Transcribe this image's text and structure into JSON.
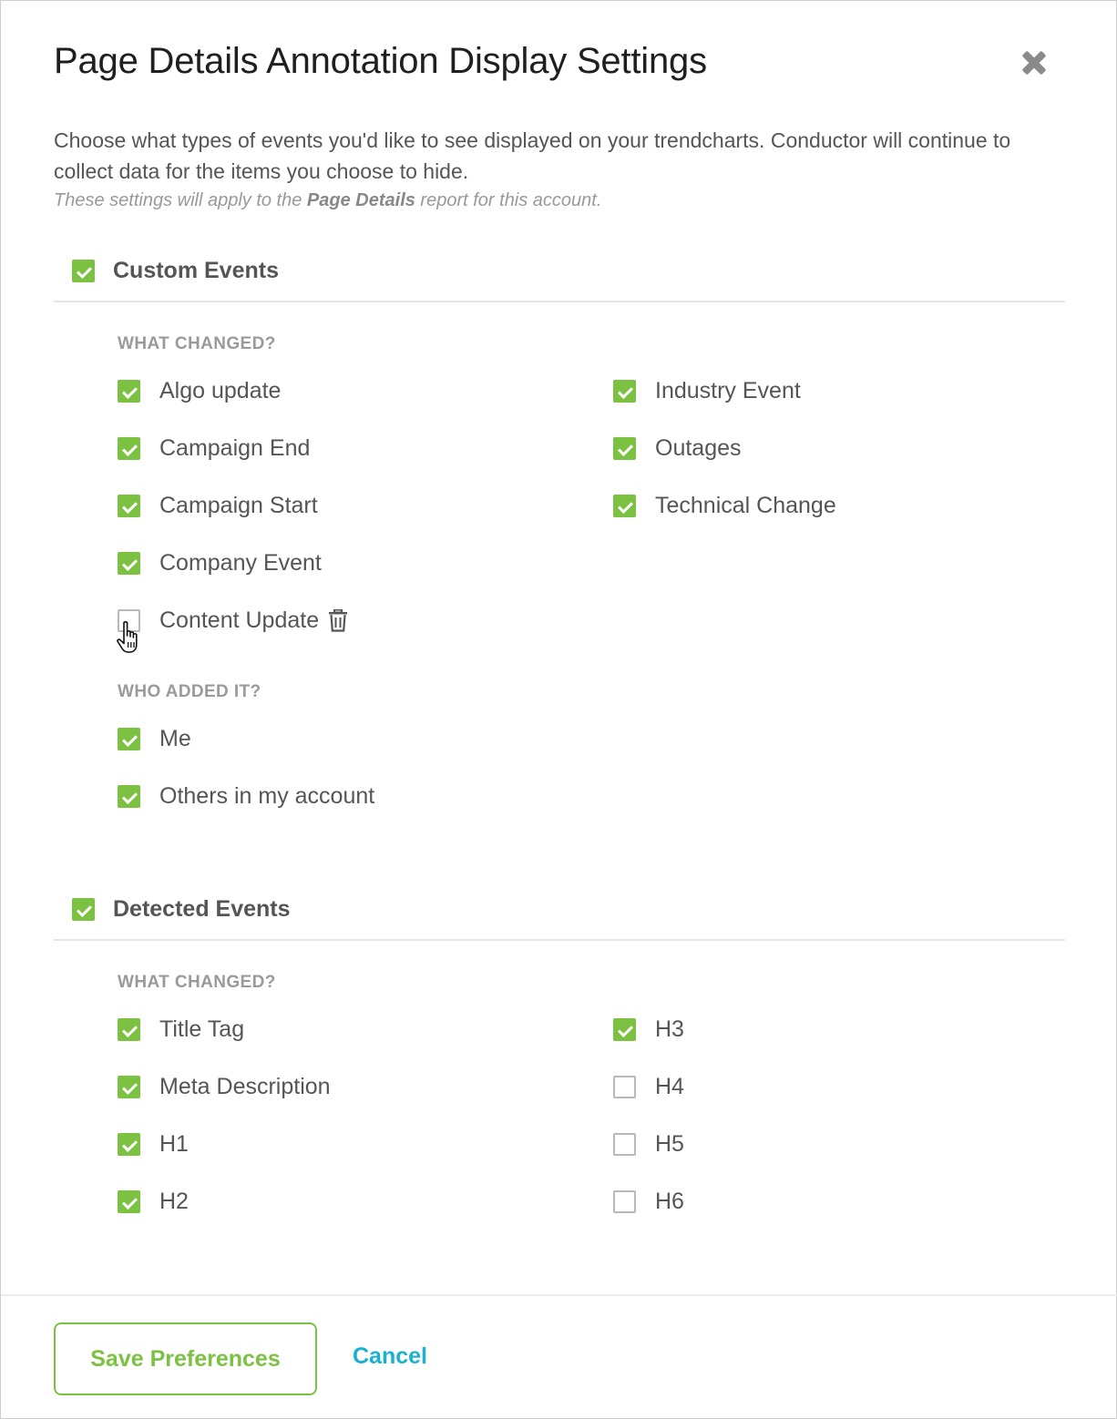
{
  "dialog": {
    "title": "Page Details Annotation Display Settings",
    "description": "Choose what types of events you'd like to see displayed on your trendcharts. Conductor will continue to collect data for the items you choose to hide.",
    "note_prefix": "These settings will apply to the ",
    "note_bold": "Page Details",
    "note_suffix": " report for this account."
  },
  "custom_events": {
    "label": "Custom Events",
    "checked": true,
    "what_changed_label": "WHAT CHANGED?",
    "items": [
      {
        "label": "Algo update",
        "checked": true
      },
      {
        "label": "Campaign End",
        "checked": true
      },
      {
        "label": "Campaign Start",
        "checked": true
      },
      {
        "label": "Company Event",
        "checked": true
      },
      {
        "label": "Content Update",
        "checked": false
      },
      {
        "label": "Industry Event",
        "checked": true
      },
      {
        "label": "Outages",
        "checked": true
      },
      {
        "label": "Technical Change",
        "checked": true
      }
    ],
    "who_added_label": "WHO ADDED IT?",
    "who_items": [
      {
        "label": "Me",
        "checked": true
      },
      {
        "label": "Others in my account",
        "checked": true
      }
    ]
  },
  "detected_events": {
    "label": "Detected Events",
    "checked": true,
    "what_changed_label": "WHAT CHANGED?",
    "items": [
      {
        "label": "Title Tag",
        "checked": true
      },
      {
        "label": "Meta Description",
        "checked": true
      },
      {
        "label": "H1",
        "checked": true
      },
      {
        "label": "H2",
        "checked": true
      },
      {
        "label": "H3",
        "checked": true
      },
      {
        "label": "H4",
        "checked": false
      },
      {
        "label": "H5",
        "checked": false
      },
      {
        "label": "H6",
        "checked": false
      }
    ]
  },
  "footer": {
    "save_label": "Save Preferences",
    "cancel_label": "Cancel"
  },
  "colors": {
    "accent_green": "#7cc242",
    "link_blue": "#1ab0d0"
  }
}
